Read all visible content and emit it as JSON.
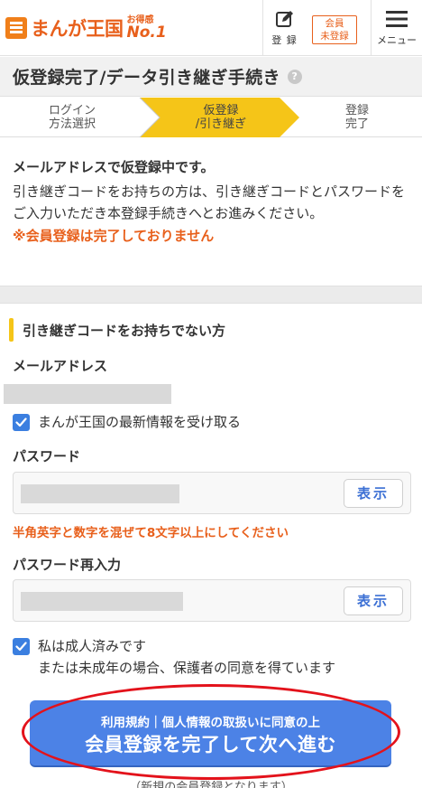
{
  "header": {
    "logo_text": "まんが王国",
    "logo_badge_small": "お得感",
    "logo_badge_big": "No.1",
    "register_label": "登 録",
    "status_line1": "会員",
    "status_line2": "未登録",
    "menu_label": "メニュー"
  },
  "page": {
    "title": "仮登録完了/データ引き継ぎ手続き",
    "help_icon_glyph": "?"
  },
  "steps": [
    {
      "line1": "ログイン",
      "line2": "方法選択",
      "active": false
    },
    {
      "line1": "仮登録",
      "line2": "/引き継ぎ",
      "active": true
    },
    {
      "line1": "登録",
      "line2": "完了",
      "active": false
    }
  ],
  "notice": {
    "line1": "メールアドレスで仮登録中です。",
    "line2": "引き継ぎコードをお持ちの方は、引き継ぎコードとパスワードをご入力いただき本登録手続きへとお進みください。",
    "warning": "※会員登録は完了しておりません"
  },
  "section": {
    "heading": "引き継ぎコードをお持ちでない方"
  },
  "email": {
    "label": "メールアドレス",
    "newsletter_checkbox_label": "まんが王国の最新情報を受け取る"
  },
  "password": {
    "label": "パスワード",
    "show_label": "表示",
    "hint": "半角英字と数字を混ぜて8文字以上にしてください",
    "confirm_label": "パスワード再入力",
    "confirm_show_label": "表示"
  },
  "age": {
    "line1": "私は成人済みです",
    "line2": "または未成年の場合、保護者の同意を得ています"
  },
  "submit": {
    "sub_label": "利用規約｜個人情報の取扱いに同意の上",
    "main_label": "会員登録を完了して次へ進む"
  },
  "footer": {
    "note": "（新規の会員登録となります）"
  },
  "colors": {
    "accent_orange": "#e8601c",
    "step_active": "#f5c518",
    "button_blue": "#4c82e6",
    "checkbox_blue": "#3b7fe0",
    "annotation_red": "#e3121b"
  },
  "icons": {
    "register": "pencil-square-icon",
    "menu": "hamburger-menu-icon",
    "help": "question-circle-icon",
    "checkbox": "checkmark-icon",
    "logo": "logo-book-icon"
  }
}
